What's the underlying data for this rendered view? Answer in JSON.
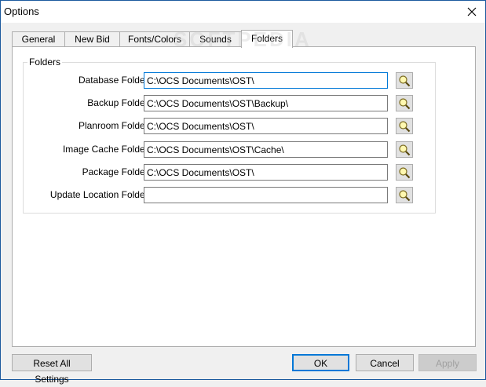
{
  "window": {
    "title": "Options",
    "close_glyph": "✕"
  },
  "tabs": [
    {
      "label": "General"
    },
    {
      "label": "New Bid"
    },
    {
      "label": "Fonts/Colors"
    },
    {
      "label": "Sounds"
    },
    {
      "label": "Folders",
      "active": true
    }
  ],
  "folders": {
    "group_label": "Folders",
    "rows": [
      {
        "label": "Database Folder:",
        "value": "C:\\OCS Documents\\OST\\"
      },
      {
        "label": "Backup Folder:",
        "value": "C:\\OCS Documents\\OST\\Backup\\"
      },
      {
        "label": "Planroom Folder:",
        "value": "C:\\OCS Documents\\OST\\"
      },
      {
        "label": "Image Cache Folder:",
        "value": "C:\\OCS Documents\\OST\\Cache\\"
      },
      {
        "label": "Package Folder:",
        "value": "C:\\OCS Documents\\OST\\"
      },
      {
        "label": "Update Location Folder:",
        "value": ""
      }
    ],
    "browse_icon": "magnifier-icon"
  },
  "buttons": {
    "reset": "Reset All Settings",
    "ok": "OK",
    "cancel": "Cancel",
    "apply": "Apply"
  },
  "watermark": "SOFTPEDIA",
  "colors": {
    "accent": "#0078d7",
    "panel": "#ffffff",
    "background": "#f0f0f0"
  }
}
